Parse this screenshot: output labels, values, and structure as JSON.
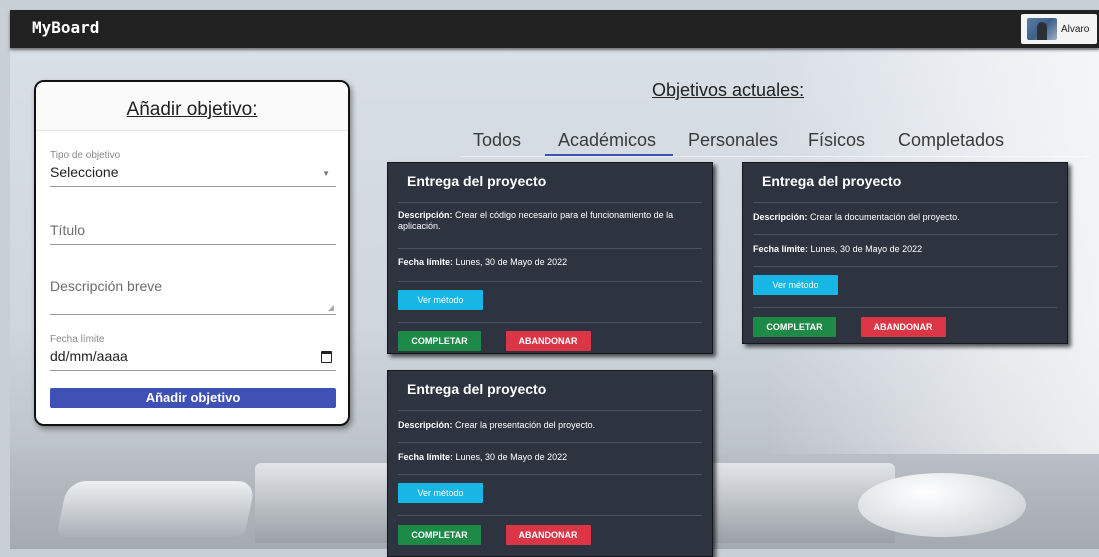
{
  "app": {
    "brand": "MyBoard"
  },
  "user": {
    "name": "Alvaro"
  },
  "form": {
    "title": "Añadir objetivo:",
    "type_label": "Tipo de objetivo",
    "type_value": "Seleccione",
    "title_placeholder": "Título",
    "desc_placeholder": "Descripción breve",
    "date_label": "Fecha límite",
    "date_value": "dd/mm/aaaa",
    "submit_label": "Añadir objetivo"
  },
  "objectives": {
    "heading": "Objetivos actuales:",
    "tabs": [
      {
        "label": "Todos",
        "active": false
      },
      {
        "label": "Académicos",
        "active": true
      },
      {
        "label": "Personales",
        "active": false
      },
      {
        "label": "Físicos",
        "active": false
      },
      {
        "label": "Completados",
        "active": false
      }
    ],
    "desc_prefix": "Descripción:",
    "date_prefix": "Fecha límite:",
    "method_label": "Ver método",
    "complete_label": "COMPLETAR",
    "abandon_label": "ABANDONAR",
    "cards": [
      {
        "title": "Entrega del proyecto",
        "description": "Crear el código necesario para el funcionamiento de la aplicación.",
        "deadline": "Lunes, 30 de Mayo de 2022"
      },
      {
        "title": "Entrega del proyecto",
        "description": "Crear la documentación del proyecto.",
        "deadline": "Lunes, 30 de Mayo de 2022"
      },
      {
        "title": "Entrega del proyecto",
        "description": "Crear la presentación del proyecto.",
        "deadline": "Lunes, 30 de Mayo de 2022"
      }
    ]
  },
  "colors": {
    "topbar": "#212121",
    "primary": "#3f51b5",
    "card": "#2d3440",
    "info": "#17b6e4",
    "success": "#1e8a48",
    "danger": "#dc3545"
  }
}
